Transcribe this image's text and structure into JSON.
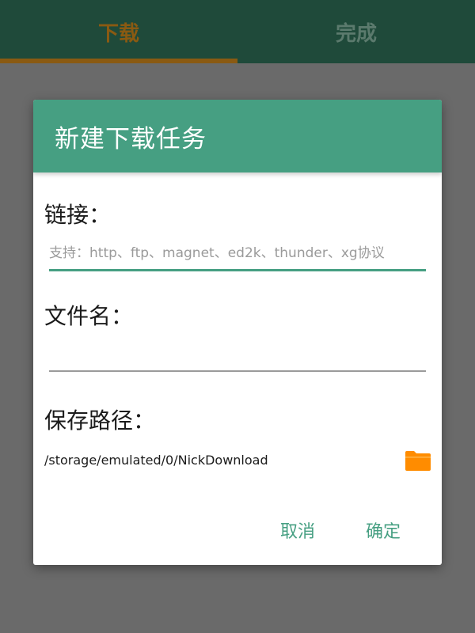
{
  "tabs": [
    {
      "label": "下载",
      "active": true
    },
    {
      "label": "完成",
      "active": false
    }
  ],
  "dialog": {
    "title": "新建下载任务",
    "link_label": "链接：",
    "link_placeholder": "支持：http、ftp、magnet、ed2k、thunder、xg协议",
    "link_value": "",
    "filename_label": "文件名：",
    "filename_value": "",
    "path_label": "保存路径：",
    "path_value": "/storage/emulated/0/NickDownload",
    "cancel_label": "取消",
    "ok_label": "确定"
  },
  "colors": {
    "accent": "#469f82",
    "folder": "#ff8c00",
    "tabbar": "#1f4a3a"
  },
  "icons": {
    "folder": "folder-icon"
  }
}
